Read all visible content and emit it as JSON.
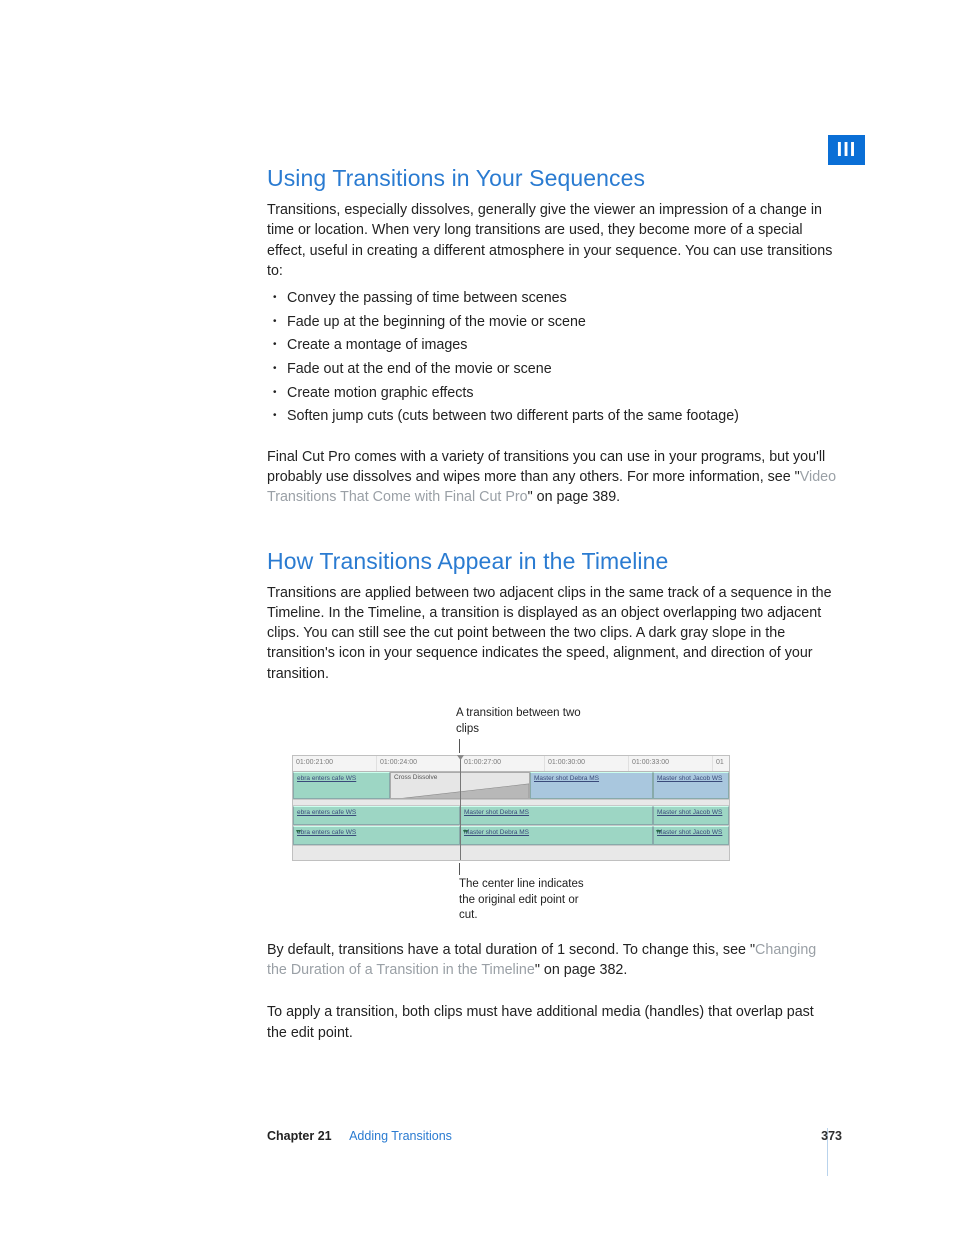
{
  "section_marker": "III",
  "h1": "Using Transitions in Your Sequences",
  "p1": "Transitions, especially dissolves, generally give the viewer an impression of a change in time or location. When very long transitions are used, they become more of a special effect, useful in creating a different atmosphere in your sequence. You can use transitions to:",
  "bullets": [
    "Convey the passing of time between scenes",
    "Fade up at the beginning of the movie or scene",
    "Create a montage of images",
    "Fade out at the end of the movie or scene",
    "Create motion graphic effects",
    "Soften jump cuts (cuts between two different parts of the same footage)"
  ],
  "p2a": "Final Cut Pro comes with a variety of transitions you can use in your programs, but you'll probably use dissolves and wipes more than any others. For more information, see \"",
  "p2_link": "Video Transitions That Come with Final Cut Pro",
  "p2b": "\" on page 389.",
  "h2": "How Transitions Appear in the Timeline",
  "p3": "Transitions are applied between two adjacent clips in the same track of a sequence in the Timeline. In the Timeline, a transition is displayed as an object overlapping two adjacent clips. You can still see the cut point between the two clips. A dark gray slope in the transition's icon in your sequence indicates the speed, alignment, and direction of your transition.",
  "callout_top": "A transition between two clips",
  "callout_bot": "The center line indicates the original edit point or cut.",
  "timeline": {
    "ticks": [
      "01:00:21:00",
      "01:00:24:00",
      "01:00:27:00",
      "01:00:30:00",
      "01:00:33:00",
      "01"
    ],
    "transition_label": "Cross Dissolve",
    "clips": {
      "a": "ebra enters cafe WS",
      "b": "Master shot Debra MS",
      "c": "Master shot Jacob WS"
    }
  },
  "p4a": "By default, transitions have a total duration of 1 second. To change this, see \"",
  "p4_link": "Changing the Duration of a Transition in the Timeline",
  "p4b": "\" on page 382.",
  "p5": "To apply a transition, both clips must have additional media (handles) that overlap past the edit point.",
  "footer": {
    "chapter_label": "Chapter 21",
    "chapter_title": "Adding Transitions",
    "page": "373"
  }
}
